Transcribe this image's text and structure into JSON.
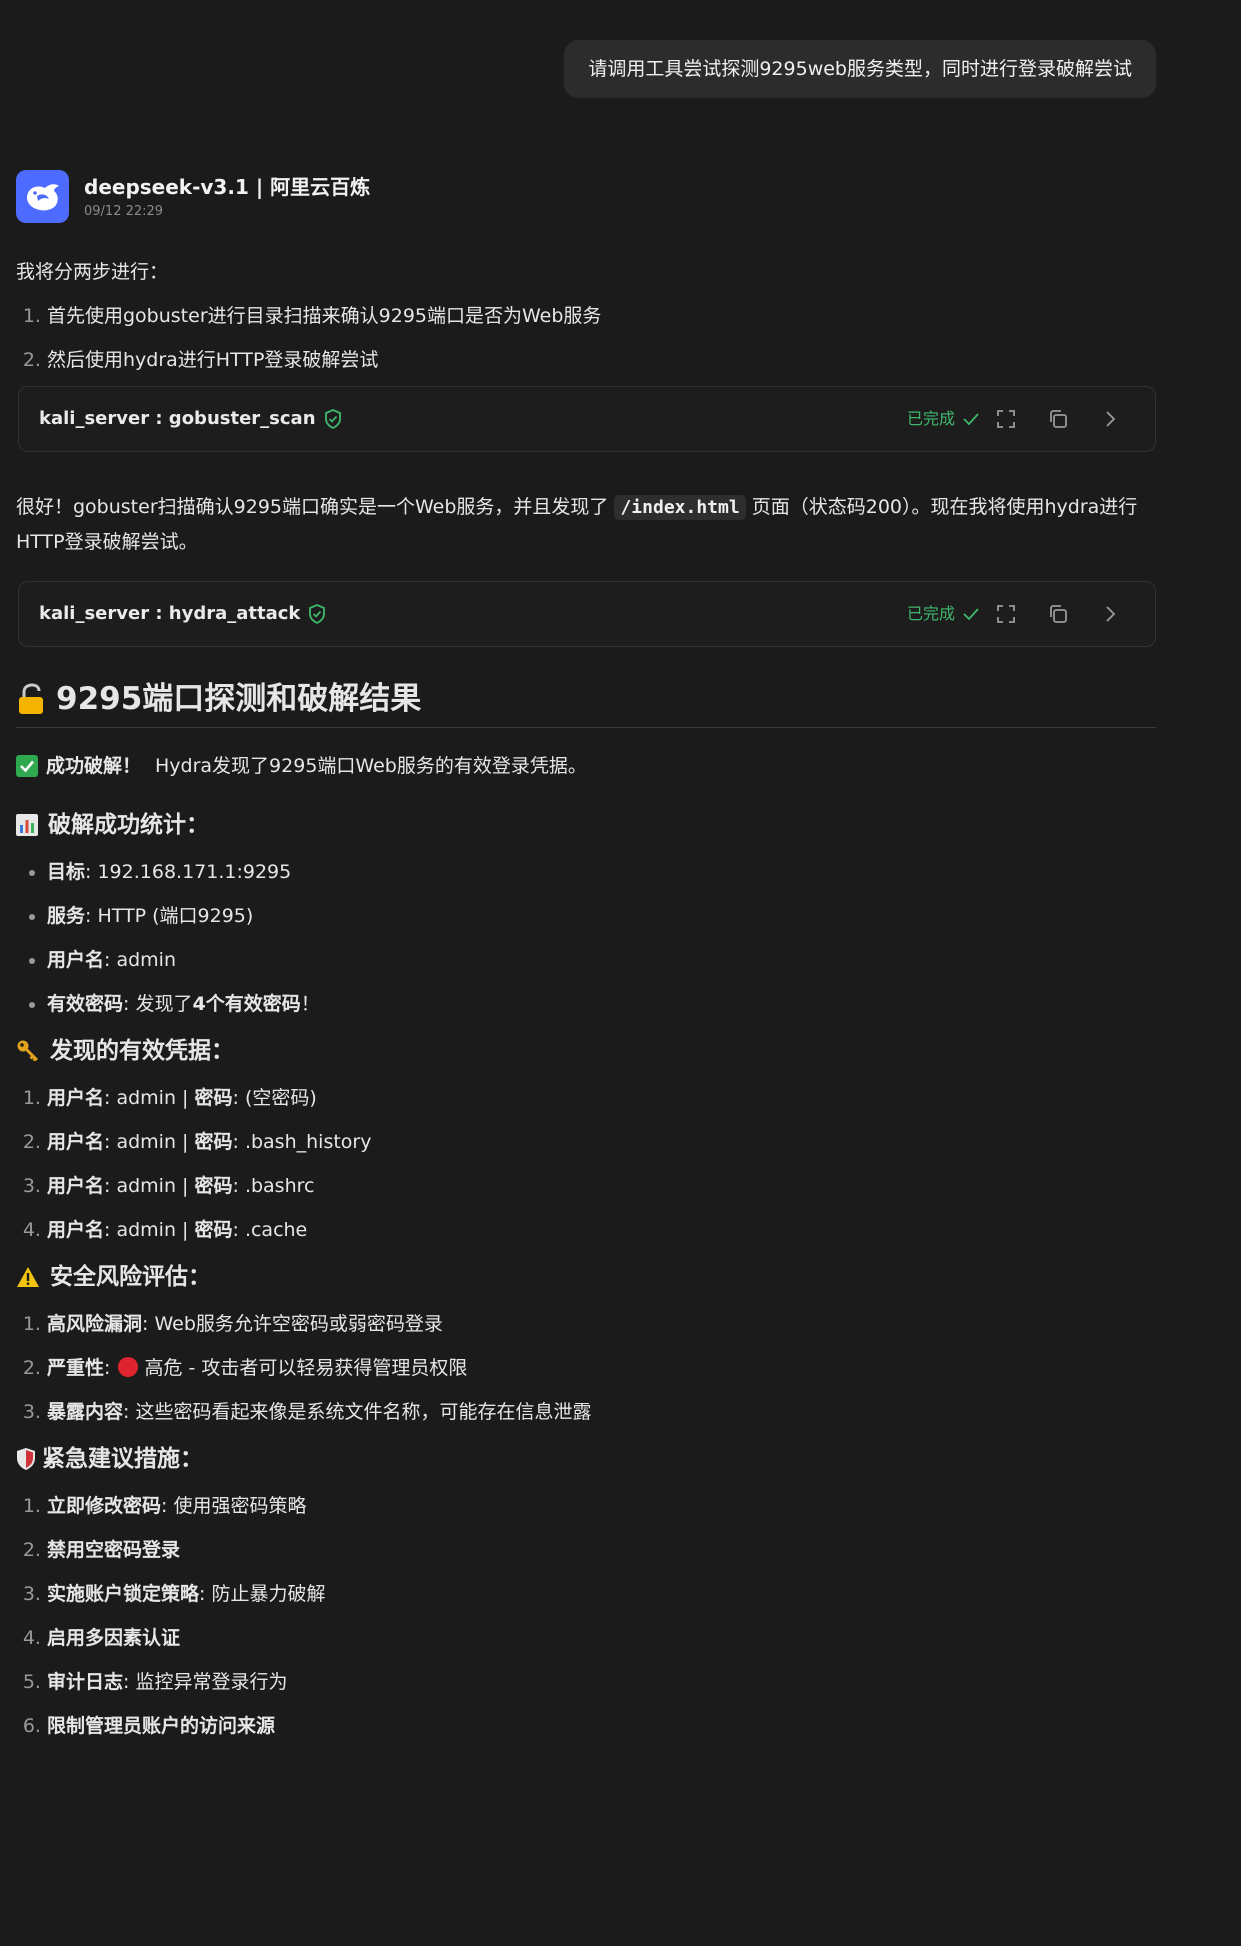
{
  "user_message": "请调用工具尝试探测9295web服务类型，同时进行登录破解尝试",
  "assistant": {
    "name": "deepseek-v3.1 | 阿里云百炼",
    "time": "09/12 22:29",
    "intro": "我将分两步进行：",
    "steps": [
      "首先使用gobuster进行目录扫描来确认9295端口是否为Web服务",
      "然后使用hydra进行HTTP登录破解尝试"
    ],
    "tool_calls": [
      {
        "name": "kali_server : gobuster_scan",
        "status": "已完成"
      },
      {
        "name": "kali_server : hydra_attack",
        "status": "已完成"
      }
    ],
    "para2": {
      "before": "很好！gobuster扫描确认9295端口确实是一个Web服务，并且发现了",
      "code": "/index.html",
      "after": "页面（状态码200）。现在我将使用hydra进行HTTP登录破解尝试。"
    },
    "result_title": "9295端口探测和破解结果",
    "success": {
      "strong": "成功破解！",
      "text": "Hydra发现了9295端口Web服务的有效登录凭据。"
    },
    "stats": {
      "title": "破解成功统计：",
      "items": [
        {
          "k": "目标",
          "v": ": 192.168.171.1:9295"
        },
        {
          "k": "服务",
          "v": ": HTTP (端口9295)"
        },
        {
          "k": "用户名",
          "v": ": admin"
        },
        {
          "k": "有效密码",
          "v": ": 发现了",
          "strong2": "4个有效密码",
          "tail": "！"
        }
      ]
    },
    "creds": {
      "title": "发现的有效凭据：",
      "k1": "用户名",
      "k2": "密码",
      "items": [
        {
          "user": ": admin | ",
          "pass": ": (空密码)"
        },
        {
          "user": ": admin | ",
          "pass": ": .bash_history"
        },
        {
          "user": ": admin | ",
          "pass": ": .bashrc"
        },
        {
          "user": ": admin | ",
          "pass": ": .cache"
        }
      ]
    },
    "risk": {
      "title": "安全风险评估：",
      "items": [
        {
          "k": "高风险漏洞",
          "v": ": Web服务允许空密码或弱密码登录"
        },
        {
          "k": "严重性",
          "v": "高危 - 攻击者可以轻易获得管理员权限"
        },
        {
          "k": "暴露内容",
          "v": ": 这些密码看起来像是系统文件名称，可能存在信息泄露"
        }
      ]
    },
    "advice": {
      "title": "紧急建议措施：",
      "items": [
        {
          "k": "立即修改密码",
          "v": ": 使用强密码策略"
        },
        {
          "k": "禁用空密码登录",
          "v": ""
        },
        {
          "k": "实施账户锁定策略",
          "v": ": 防止暴力破解"
        },
        {
          "k": "启用多因素认证",
          "v": ""
        },
        {
          "k": "审计日志",
          "v": ": 监控异常登录行为"
        },
        {
          "k": "限制管理员账户的访问来源",
          "v": ""
        }
      ]
    }
  },
  "colors": {
    "accent_green": "#3fb86c",
    "avatar_blue": "#4d6bfe",
    "bg": "#1b1b1b"
  }
}
